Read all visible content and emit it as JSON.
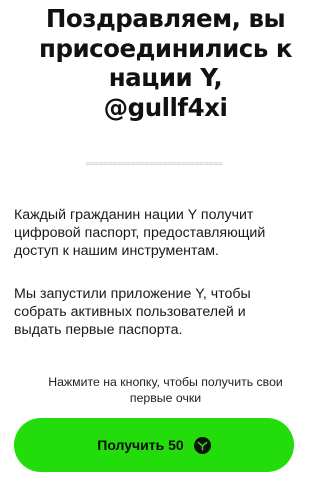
{
  "heading": {
    "line_1": "Поздравляем, вы",
    "line_2": "присоединились к",
    "line_3": "нации Y,",
    "line_4": "@gullf4xi"
  },
  "divider": "==============================",
  "intro": {
    "line_1": "Каждый гражданин нации Y получит",
    "line_2": "цифровой паспорт, предоставляющий",
    "line_3": "доступ к нашим инструментам."
  },
  "launch": {
    "line_1": "Мы запустили приложение Y, чтобы",
    "line_2": "собрать активных пользователей и",
    "line_3": "выдать первые паспорта."
  },
  "hint": {
    "line_1": "Нажмите на кнопку, чтобы получить свои",
    "line_2": "первые очки"
  },
  "cta": {
    "label": "Получить 50",
    "icon": "y-token-icon",
    "color": "#22dc0c"
  }
}
